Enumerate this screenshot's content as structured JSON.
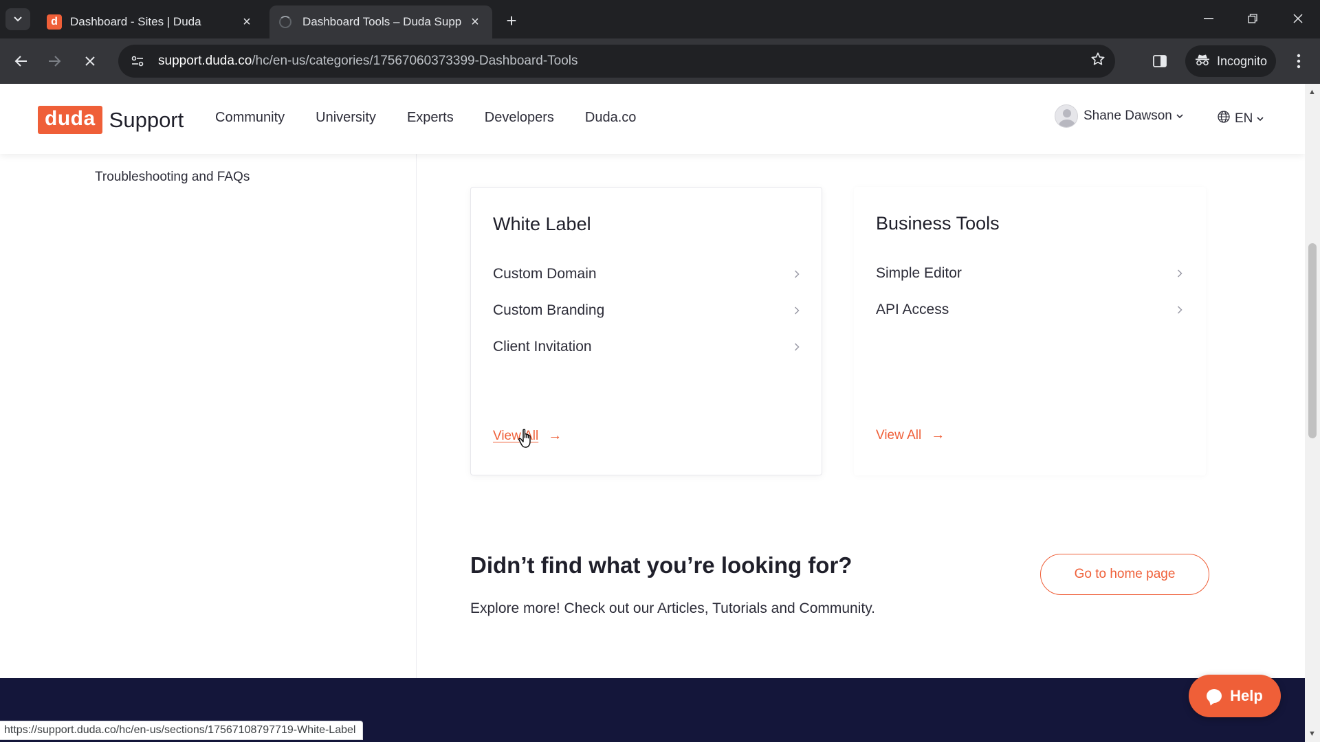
{
  "browser": {
    "tabs": [
      {
        "title": "Dashboard - Sites | Duda",
        "favicon": "duda-icon",
        "active": false
      },
      {
        "title": "Dashboard Tools – Duda Suppc",
        "favicon": "loading-spinner-icon",
        "active": true
      }
    ],
    "url_host": "support.duda.co",
    "url_path": "/hc/en-us/categories/17567060373399-Dashboard-Tools",
    "profile_label": "Incognito",
    "status_url": "https://support.duda.co/hc/en-us/sections/17567108797719-White-Label"
  },
  "header": {
    "logo_word": "duda",
    "logo_suffix": "Support",
    "nav": [
      "Community",
      "University",
      "Experts",
      "Developers",
      "Duda.co"
    ],
    "user_name": "Shane Dawson",
    "language": "EN"
  },
  "sidebar": {
    "link": "Troubleshooting and FAQs"
  },
  "cards": [
    {
      "title": "White Label",
      "items": [
        "Custom Domain",
        "Custom Branding",
        "Client Invitation"
      ],
      "view_all": "View All"
    },
    {
      "title": "Business Tools",
      "items": [
        "Simple Editor",
        "API Access"
      ],
      "view_all": "View All"
    }
  ],
  "not_found": {
    "heading": "Didn’t find what you’re looking for?",
    "subtext": "Explore more! Check out our Articles, Tutorials and Community.",
    "button": "Go to home page"
  },
  "help_button": "Help",
  "colors": {
    "brand_orange": "#ef5f38",
    "footer_navy": "#14163a",
    "chrome_dark": "#202124"
  }
}
